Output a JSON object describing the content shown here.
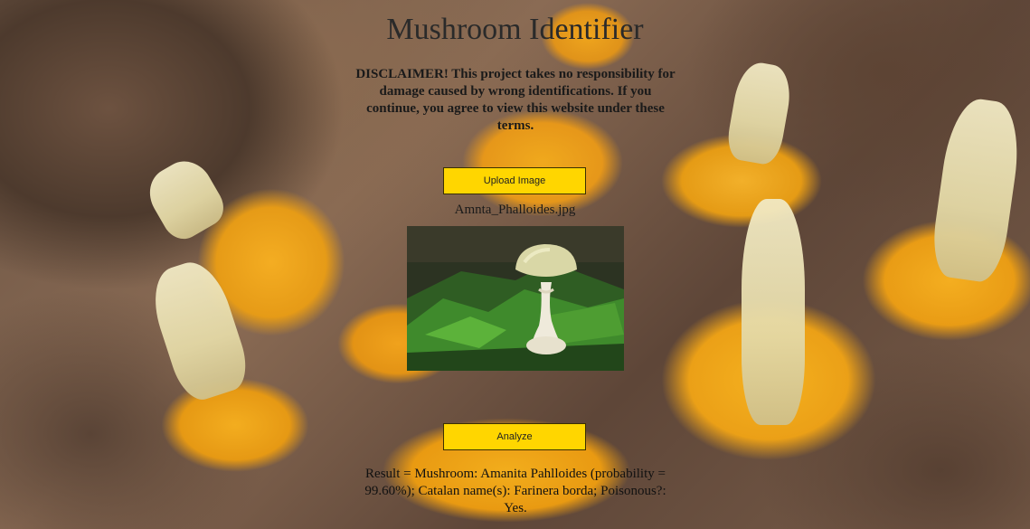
{
  "page": {
    "title": "Mushroom Identifier",
    "disclaimer": "DISCLAIMER! This project takes no responsibility for damage caused by wrong identifications. If you continue, you agree to view this website under these terms."
  },
  "upload": {
    "button_label": "Upload Image",
    "file_name": "Amnta_Phalloides.jpg"
  },
  "analyze": {
    "button_label": "Analyze"
  },
  "result": {
    "text": "Result = Mushroom: Amanita Pahlloides (probability = 99.60%); Catalan name(s): Farinera borda; Poisonous?: Yes."
  },
  "colors": {
    "button_bg": "#ffd600",
    "button_border": "#3a3000",
    "title_text": "#2a2a2a"
  },
  "icons": {
    "background": "chanterelle-mushrooms-photo",
    "preview": "amanita-phalloides-photo"
  }
}
